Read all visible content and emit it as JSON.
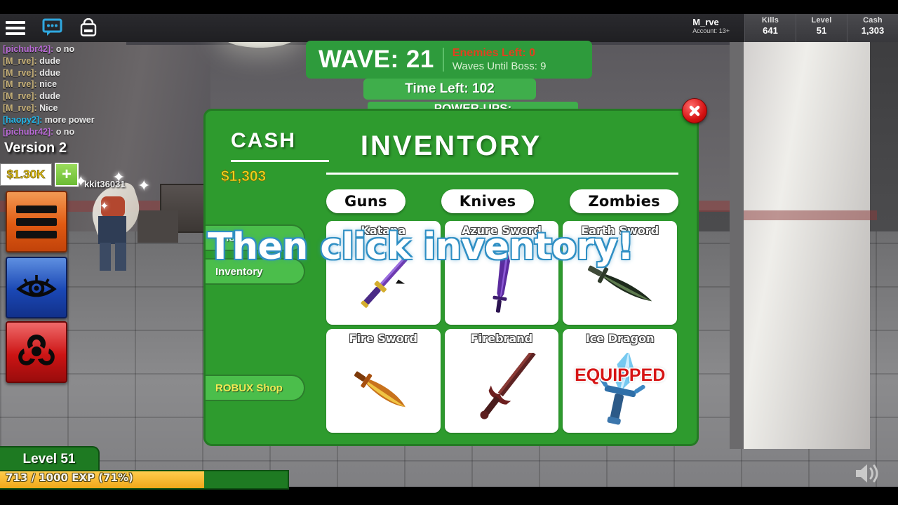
{
  "topbar": {
    "icons": [
      {
        "name": "menu-icon",
        "label": "Menu"
      },
      {
        "name": "chat-icon",
        "label": "Chat"
      },
      {
        "name": "backpack-icon",
        "label": "Backpack"
      }
    ],
    "player": {
      "name": "M_rve",
      "account": "Account: 13+"
    },
    "stats": [
      {
        "key": "Kills",
        "value": "641"
      },
      {
        "key": "Level",
        "value": "51"
      },
      {
        "key": "Cash",
        "value": "1,303"
      }
    ]
  },
  "chat": {
    "messages": [
      {
        "user": "[pichubr42]:",
        "text": "o no",
        "color": "#b96bd6"
      },
      {
        "user": "[M_rve]:",
        "text": "dude",
        "color": "#c9b37a"
      },
      {
        "user": "[M_rve]:",
        "text": "ddue",
        "color": "#c9b37a"
      },
      {
        "user": "[M_rve]:",
        "text": "nice",
        "color": "#c9b37a"
      },
      {
        "user": "[M_rve]:",
        "text": "dude",
        "color": "#c9b37a"
      },
      {
        "user": "[M_rve]:",
        "text": "Nice",
        "color": "#c9b37a"
      },
      {
        "user": "[haopy2]:",
        "text": "more power",
        "color": "#24b6e8"
      },
      {
        "user": "[pichubr42]:",
        "text": "o no",
        "color": "#b96bd6"
      }
    ],
    "version": "Version 2"
  },
  "hud": {
    "cash_short": "$1.30K",
    "plus_label": "+",
    "side_buttons": [
      {
        "name": "menu-bars-button",
        "icon": "bars-icon"
      },
      {
        "name": "eye-button",
        "icon": "eye-icon"
      },
      {
        "name": "biohazard-button",
        "icon": "biohazard-icon"
      }
    ],
    "nametag": "kkit36031"
  },
  "wave": {
    "label": "WAVE: 21",
    "enemies_left": "Enemies Left: 0",
    "waves_until_boss": "Waves Until Boss: 9",
    "time_left": "Time Left: 102",
    "powerups": "POWER-UPS:"
  },
  "panel": {
    "cash_title": "CASH",
    "cash_value": "$1,303",
    "title": "INVENTORY",
    "close_label": "Close",
    "tabs": [
      {
        "label": "Guns",
        "selected": false
      },
      {
        "label": "Knives",
        "selected": true
      },
      {
        "label": "Zombies",
        "selected": false
      }
    ],
    "sidebar": [
      {
        "label": "Shop",
        "name": "sidebar-item-shop"
      },
      {
        "label": "Inventory",
        "name": "sidebar-item-inventory"
      },
      {
        "label": "ROBUX Shop",
        "name": "sidebar-item-robux-shop"
      }
    ],
    "items": [
      {
        "name": "Katana",
        "equipped": false,
        "sword": "katana"
      },
      {
        "name": "Azure Sword",
        "equipped": false,
        "sword": "azure"
      },
      {
        "name": "Earth Sword",
        "equipped": false,
        "sword": "earth"
      },
      {
        "name": "Fire Sword",
        "equipped": false,
        "sword": "fire"
      },
      {
        "name": "Firebrand",
        "equipped": false,
        "sword": "firebrand"
      },
      {
        "name": "Ice Dragon",
        "equipped": true,
        "sword": "ice",
        "equipped_label": "EQUIPPED"
      }
    ]
  },
  "caption": "Then click inventory!",
  "bottom": {
    "level": "Level 51",
    "exp_text": "713 / 1000 EXP (71%)",
    "exp_percent": 71
  },
  "colors": {
    "panel_green": "#2e9b2e",
    "banner_green": "#2e9b3c",
    "cash_yellow": "#edd21c",
    "equipped_red": "#d61515",
    "caption_outline": "#2f8fc4"
  }
}
